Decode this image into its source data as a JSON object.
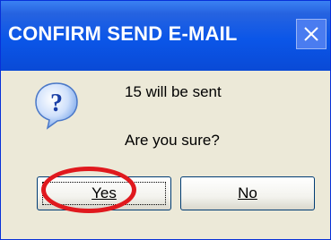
{
  "window": {
    "title": "CONFIRM SEND E-MAIL"
  },
  "icons": {
    "close": "close-icon",
    "question": "question-icon"
  },
  "message": {
    "line1": "15 will be sent",
    "line2": "Are you sure?"
  },
  "buttons": {
    "yes_label": "Yes",
    "no_label": "No"
  },
  "colors": {
    "titlebar": "#0b56e8",
    "highlight": "#e0191e",
    "dialog_bg": "#ece9d8"
  }
}
